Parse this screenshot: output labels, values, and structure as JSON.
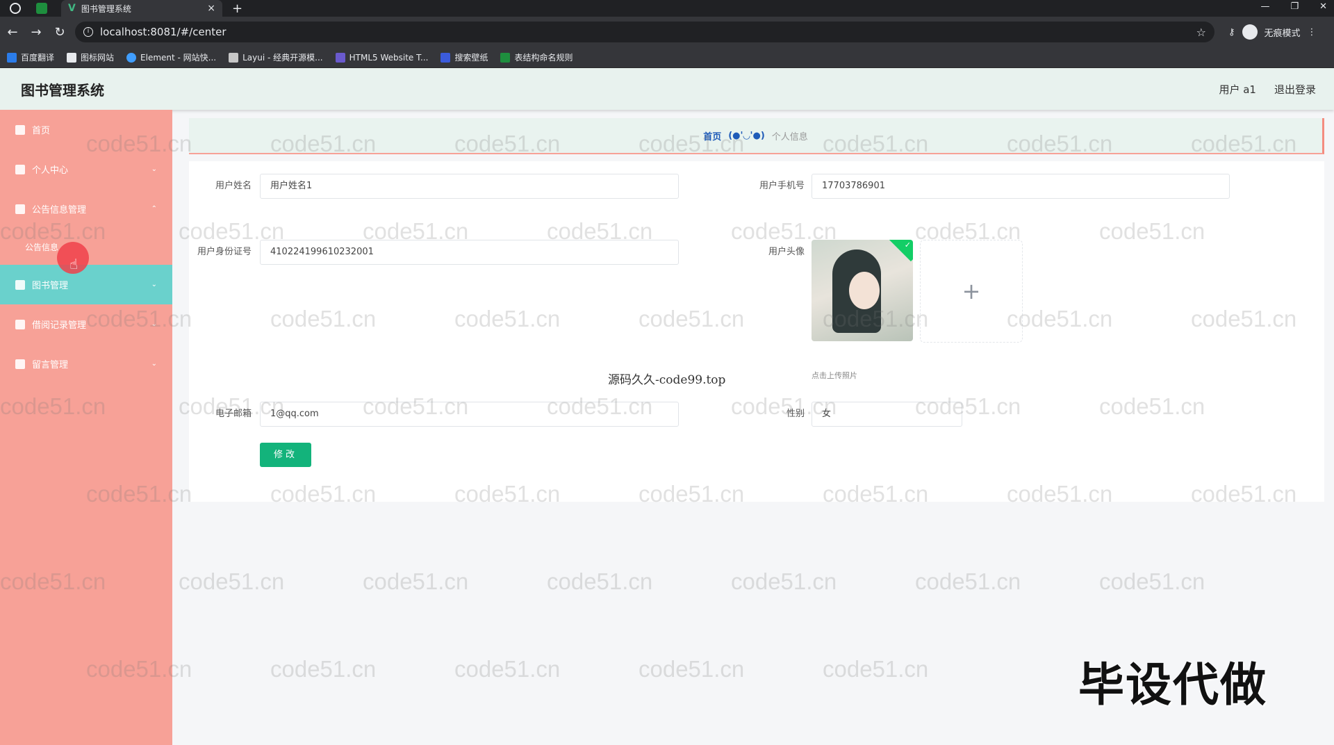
{
  "browser": {
    "tab_title": "图书管理系统",
    "tab_close": "×",
    "new_tab": "+",
    "url": "localhost:8081/#/center",
    "profile_label": "无痕模式",
    "bookmarks": [
      "百度翻译",
      "图标网站",
      "Element - 网站快...",
      "Layui - 经典开源模...",
      "HTML5 Website T...",
      "搜索壁纸",
      "表结构命名规则"
    ]
  },
  "header": {
    "title": "图书管理系统",
    "user_label": "用户 a1",
    "logout_label": "退出登录"
  },
  "sidebar": {
    "items": [
      {
        "label": "首页",
        "chevron": ""
      },
      {
        "label": "个人中心",
        "chevron": "⌄"
      },
      {
        "label": "公告信息管理",
        "chevron": "⌃"
      },
      {
        "label": "公告信息",
        "chevron": ""
      },
      {
        "label": "图书管理",
        "chevron": "⌄"
      },
      {
        "label": "借阅记录管理",
        "chevron": "⌄"
      },
      {
        "label": "留言管理",
        "chevron": "⌄"
      }
    ]
  },
  "breadcrumb": {
    "home": "首页",
    "separator": "(●'◡'●)",
    "current": "个人信息"
  },
  "form": {
    "name_label": "用户姓名",
    "name_value": "用户姓名1",
    "phone_label": "用户手机号",
    "phone_value": "17703786901",
    "id_label": "用户身份证号",
    "id_value": "410224199610232001",
    "avatar_label": "用户头像",
    "upload_tip": "点击上传照片",
    "email_label": "电子邮箱",
    "email_value": "1@qq.com",
    "gender_label": "性别",
    "gender_value": "女",
    "submit_label": "修改"
  },
  "overlay": {
    "caption": "源码久久-code99.top",
    "watermark": "code51.cn",
    "big_mark": "毕设代做"
  },
  "colors": {
    "sidebar_bg": "#f7a197",
    "sidebar_active": "#6ad1cc",
    "header_bg": "#e8f2ee",
    "primary_button": "#13b37b"
  }
}
